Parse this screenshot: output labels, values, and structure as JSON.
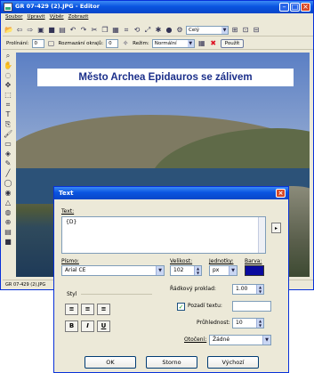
{
  "window": {
    "title": "GR 07-429 (2).JPG - Editor"
  },
  "menu": [
    "Soubor",
    "Upravit",
    "Výběr",
    "Zobrazit"
  ],
  "toolbar": {
    "font_combo": "Celý"
  },
  "options_bar": {
    "feather_label": "Prolínání:",
    "feather_value": "0",
    "rounding_label": "Rozmazání okrajů:",
    "rounding_value": "0",
    "mode_label": "Režim:",
    "mode_value": "Normální",
    "apply_label": "Použít"
  },
  "canvas": {
    "banner_text": "Město Archea Epidauros se zálivem"
  },
  "statusbar": {
    "text": "GR 07-429 (2).JPG"
  },
  "dialog": {
    "title": "Text",
    "text_label": "Text:",
    "text_value": "{D}",
    "font_label": "Písmo:",
    "font_value": "Arial CE",
    "size_label": "Velikost:",
    "size_value": "102",
    "units_label": "Jednotky:",
    "units_value": "px",
    "color_label": "Barva:",
    "color_value": "#0a0a9e",
    "style_label": "Styl",
    "line_spacing_label": "Řádkový proklad:",
    "line_spacing_value": "1.00",
    "text_bg_label": "Pozadí textu:",
    "opacity_label": "Průhlednost:",
    "opacity_value": "10",
    "rotation_label": "Otočení:",
    "rotation_value": "Žádné",
    "ok_label": "OK",
    "cancel_label": "Storno",
    "default_label": "Výchozí"
  }
}
